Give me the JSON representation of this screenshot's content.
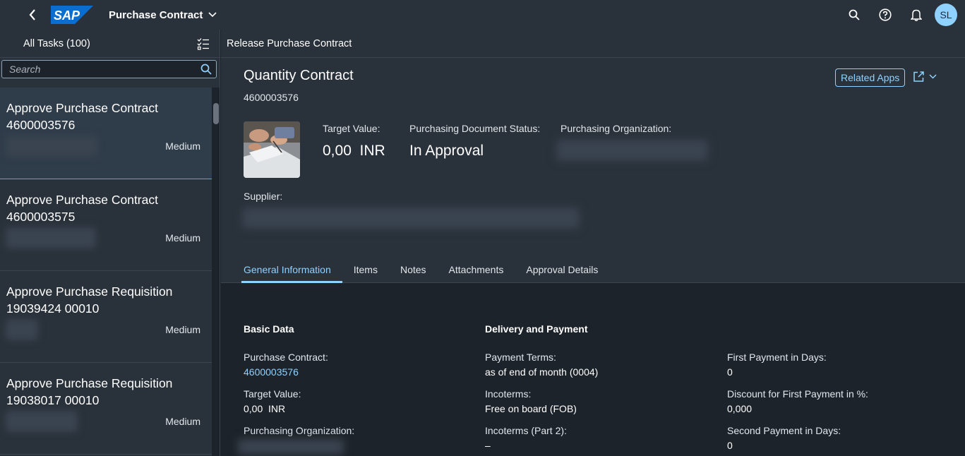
{
  "shell": {
    "app_title": "Purchase Contract",
    "logo_text": "SAP",
    "avatar_initials": "SL"
  },
  "master": {
    "title": "All Tasks (100)",
    "search_placeholder": "Search",
    "items": [
      {
        "title": "Approve Purchase Contract 4600003576",
        "priority": "Medium"
      },
      {
        "title": "Approve Purchase Contract 4600003575",
        "priority": "Medium"
      },
      {
        "title": "Approve Purchase Requisition 19039424 00010",
        "priority": "Medium"
      },
      {
        "title": "Approve Purchase Requisition 19038017 00010",
        "priority": "Medium"
      }
    ]
  },
  "detail": {
    "bar_title": "Release Purchase Contract",
    "object_title": "Quantity Contract",
    "object_subtitle": "4600003576",
    "related_apps": "Related Apps",
    "kpis": {
      "target_value_label": "Target Value:",
      "target_value": "0,00  INR",
      "status_label": "Purchasing Document Status:",
      "status_value": "In Approval",
      "org_label": "Purchasing Organization:"
    },
    "supplier_label": "Supplier:",
    "tabs": [
      "General Information",
      "Items",
      "Notes",
      "Attachments",
      "Approval Details"
    ],
    "basic_data": {
      "title": "Basic Data",
      "purchase_contract_label": "Purchase Contract:",
      "purchase_contract_value": "4600003576",
      "target_value_label": "Target Value:",
      "target_value_value": "0,00  INR",
      "org_label": "Purchasing Organization:"
    },
    "delivery": {
      "title": "Delivery and Payment",
      "payment_terms_label": "Payment Terms:",
      "payment_terms_value": "as of end of month (0004)",
      "incoterms_label": "Incoterms:",
      "incoterms_value": "Free on board (FOB)",
      "incoterms2_label": "Incoterms (Part 2):",
      "incoterms2_value": "–"
    },
    "payment": {
      "first_days_label": "First Payment in Days:",
      "first_days_value": "0",
      "discount_label": "Discount for First Payment in %:",
      "discount_value": "0,000",
      "second_days_label": "Second Payment in Days:",
      "second_days_value": "0"
    }
  },
  "colors": {
    "shell": "#29313a",
    "background": "#1d232a",
    "accent": "#8fd1ff",
    "sap_logo": "#0a6ed1"
  }
}
